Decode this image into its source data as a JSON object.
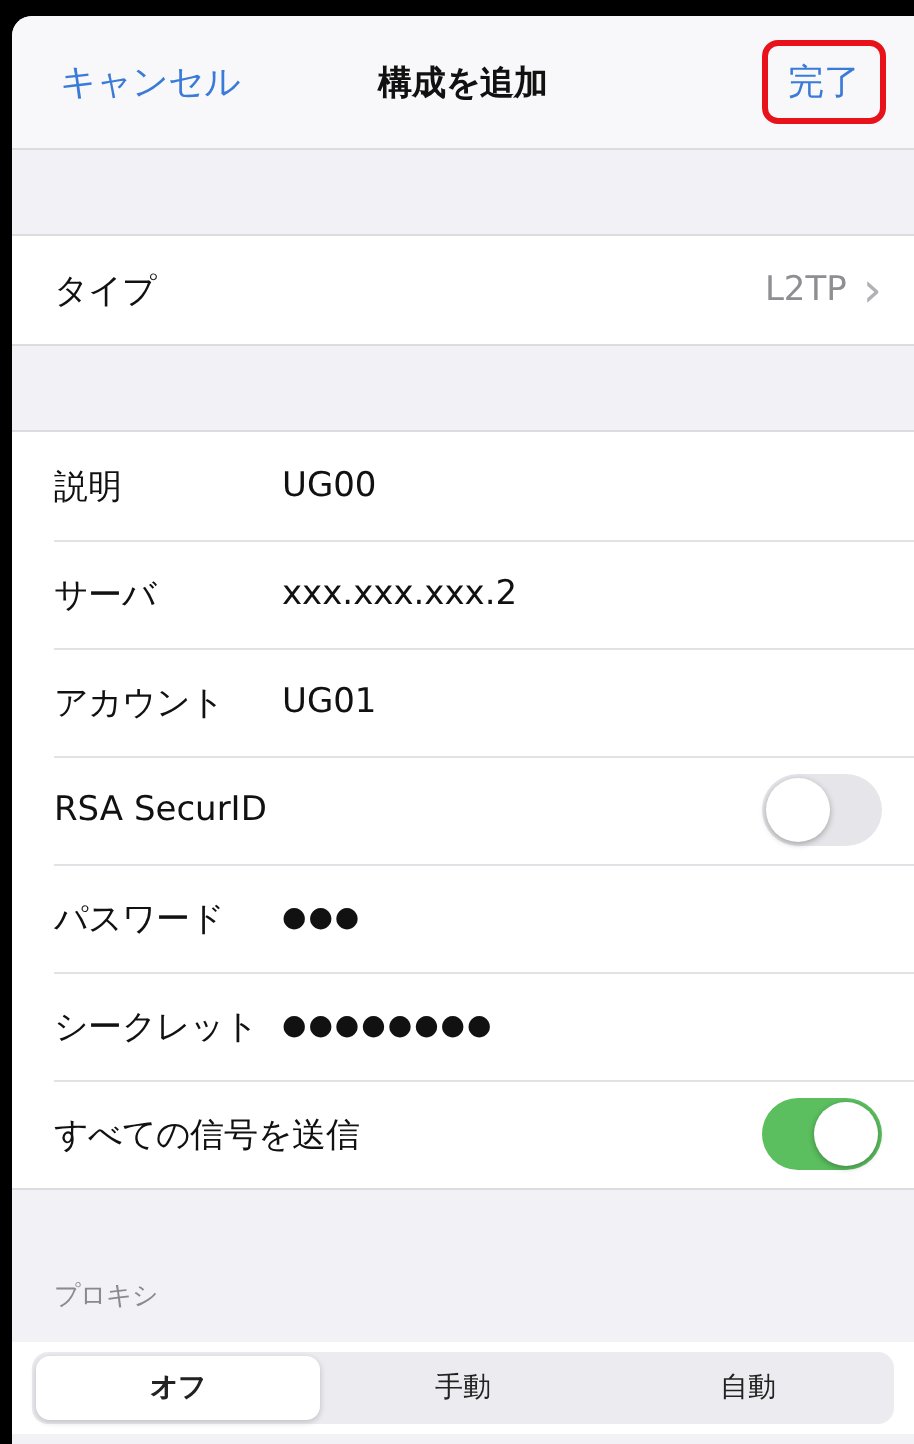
{
  "nav": {
    "cancel": "キャンセル",
    "title": "構成を追加",
    "done": "完了",
    "done_highlighted": true
  },
  "type_row": {
    "label": "タイプ",
    "value": "L2TP",
    "chevron": "›"
  },
  "fields": [
    {
      "kind": "text",
      "label": "説明",
      "value": "UG00"
    },
    {
      "kind": "text",
      "label": "サーバ",
      "value": "xxx.xxx.xxx.2"
    },
    {
      "kind": "text",
      "label": "アカウント",
      "value": "UG01"
    },
    {
      "kind": "toggle",
      "label": "RSA SecurID",
      "on": false
    },
    {
      "kind": "secret",
      "label": "パスワード",
      "value": "●●●"
    },
    {
      "kind": "secret",
      "label": "シークレット",
      "value": "●●●●●●●●"
    },
    {
      "kind": "toggle",
      "label": "すべての信号を送信",
      "on": true
    }
  ],
  "proxy": {
    "header": "プロキシ",
    "segments": [
      {
        "label": "オフ",
        "selected": true
      },
      {
        "label": "手動",
        "selected": false
      },
      {
        "label": "自動",
        "selected": false
      }
    ]
  }
}
